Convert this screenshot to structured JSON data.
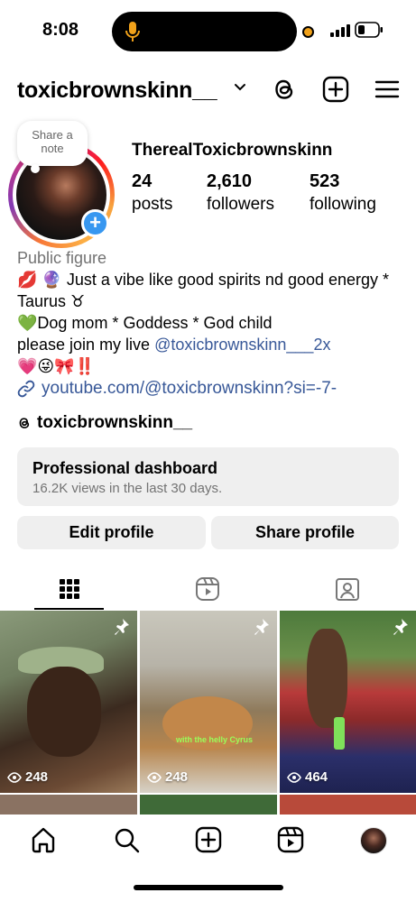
{
  "status_bar": {
    "time": "8:08"
  },
  "header": {
    "username": "toxicbrownskinn__"
  },
  "profile": {
    "note_label": "Share a note",
    "display_name": "TherealToxicbrownskinn",
    "stats": [
      {
        "value": "24",
        "label": "posts"
      },
      {
        "value": "2,610",
        "label": "followers"
      },
      {
        "value": "523",
        "label": "following"
      }
    ]
  },
  "bio": {
    "category": "Public figure",
    "line1": "💋 🔮 Just a vibe like good spirits nd good energy * Taurus ♉",
    "line2": "💚Dog mom * Goddess * God child",
    "line3_prefix": "please join my live ",
    "line3_mention": "@toxicbrownskinn___2x",
    "line4": "💗😜🎀‼️",
    "link": "youtube.com/@toxicbrownskinn?si=-7-",
    "threads_handle": "toxicbrownskinn__"
  },
  "dashboard": {
    "title": "Professional dashboard",
    "subtitle": "16.2K views in the last 30 days."
  },
  "buttons": {
    "edit": "Edit profile",
    "share": "Share profile"
  },
  "grid": {
    "posts": [
      {
        "views": "248"
      },
      {
        "views": "248",
        "caption": "with the helly Cyrus"
      },
      {
        "views": "464"
      }
    ]
  },
  "icons": {
    "threads": "threads-icon",
    "new_post": "plus-square-icon",
    "menu": "hamburger-menu-icon",
    "grid_tab": "grid-icon",
    "reels_tab": "reels-icon",
    "tagged_tab": "tagged-icon",
    "home": "home-icon",
    "search": "search-icon",
    "create": "create-icon",
    "reels": "reels-icon"
  },
  "colors": {
    "link": "#385898",
    "badge": "#3797f0",
    "secondary": "#737373",
    "battery_dot": "#f0a11a"
  }
}
